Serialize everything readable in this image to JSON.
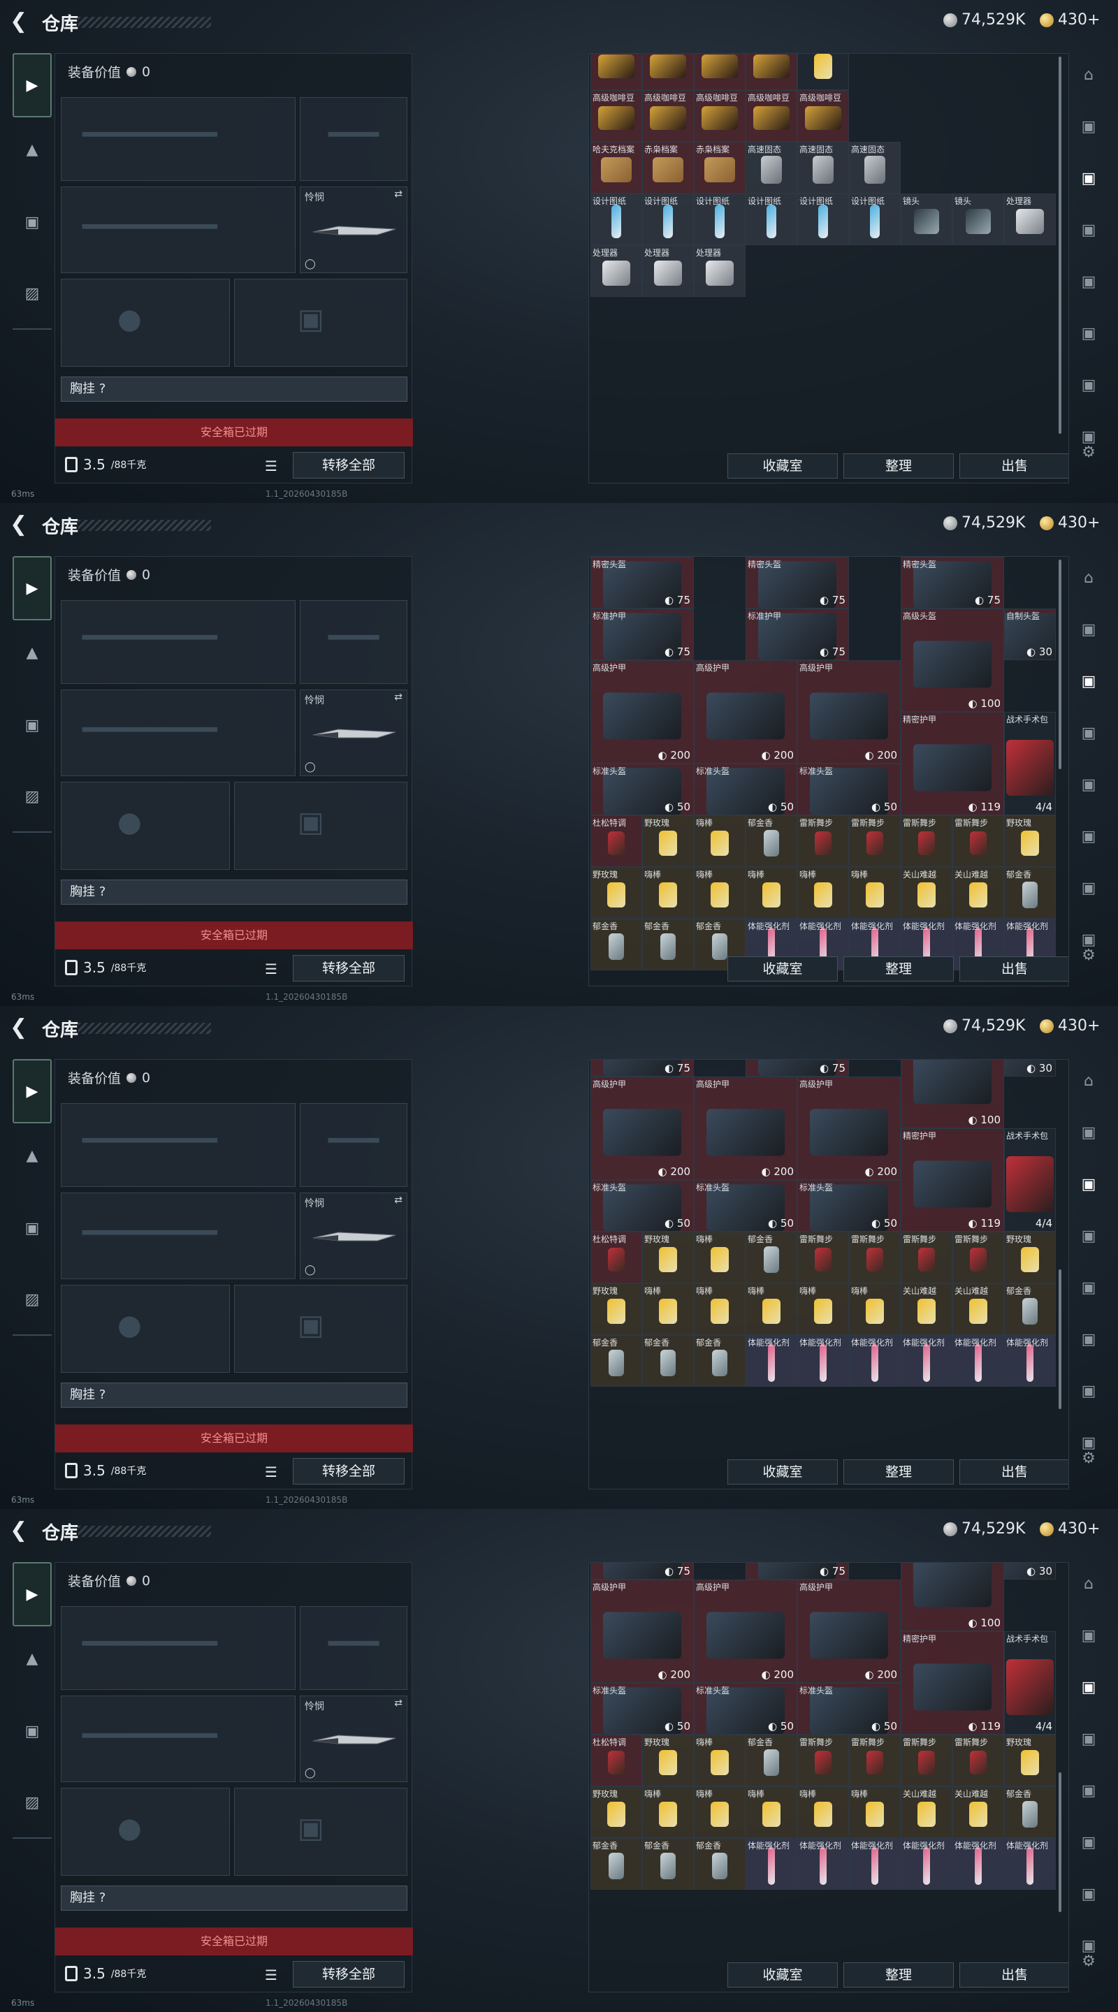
{
  "header": {
    "back_icon": "back-arrow-icon",
    "title": "仓库",
    "silver": "74,529K",
    "gold": "430+"
  },
  "left_nav": [
    "pistol-icon",
    "helmet-icon",
    "backpack-icon",
    "briefcase-icon"
  ],
  "equipment": {
    "value_label": "装备价值",
    "value": "0",
    "knife_label": "怜悯",
    "chest_label": "胸挂 ?",
    "safe_box": "安全箱已过期",
    "weight": "3.5",
    "weight_max": "/88千克",
    "transfer_all": "转移全部"
  },
  "buttons": {
    "collection": "收藏室",
    "sort": "整理",
    "sell": "出售"
  },
  "status": {
    "ping": "63ms",
    "build": "1.1_20260430185B"
  },
  "frames": [
    {
      "cells": [
        {
          "c": 0,
          "r": 0,
          "n": "高级咖啡豆"
        },
        {
          "c": 1,
          "r": 0,
          "n": "高级咖啡豆"
        },
        {
          "c": 2,
          "r": 0,
          "n": "高级咖啡豆"
        },
        {
          "c": 3,
          "r": 0,
          "n": "高级咖啡豆"
        },
        {
          "c": 4,
          "r": 0,
          "n": ""
        },
        {
          "c": 0,
          "r": 1,
          "n": "高级咖啡豆"
        },
        {
          "c": 1,
          "r": 1,
          "n": "高级咖啡豆"
        },
        {
          "c": 2,
          "r": 1,
          "n": "高级咖啡豆"
        },
        {
          "c": 3,
          "r": 1,
          "n": "高级咖啡豆"
        },
        {
          "c": 4,
          "r": 1,
          "n": "高级咖啡豆"
        },
        {
          "c": 0,
          "r": 2,
          "n": "哈夫克档案"
        },
        {
          "c": 1,
          "r": 2,
          "n": "赤枭档案"
        },
        {
          "c": 2,
          "r": 2,
          "n": "赤枭档案"
        },
        {
          "c": 3,
          "r": 2,
          "n": "高速固态"
        },
        {
          "c": 4,
          "r": 2,
          "n": "高速固态"
        },
        {
          "c": 5,
          "r": 2,
          "n": "高速固态"
        },
        {
          "c": 0,
          "r": 3,
          "n": "设计图纸"
        },
        {
          "c": 1,
          "r": 3,
          "n": "设计图纸"
        },
        {
          "c": 2,
          "r": 3,
          "n": "设计图纸"
        },
        {
          "c": 3,
          "r": 3,
          "n": "设计图纸"
        },
        {
          "c": 4,
          "r": 3,
          "n": "设计图纸"
        },
        {
          "c": 5,
          "r": 3,
          "n": "设计图纸"
        },
        {
          "c": 6,
          "r": 3,
          "n": "镜头"
        },
        {
          "c": 7,
          "r": 3,
          "n": "镜头"
        },
        {
          "c": 8,
          "r": 3,
          "n": "处理器"
        },
        {
          "c": 0,
          "r": 4,
          "n": "处理器"
        },
        {
          "c": 1,
          "r": 4,
          "n": "处理器"
        },
        {
          "c": 2,
          "r": 4,
          "n": "处理器"
        }
      ]
    },
    {
      "cells": [
        {
          "c": 0,
          "r": 0,
          "n": "精密头盔",
          "v": "75"
        },
        {
          "c": 3,
          "r": 0,
          "n": "精密头盔",
          "v": "75"
        },
        {
          "c": 6,
          "r": 0,
          "n": "精密头盔",
          "v": "75"
        },
        {
          "c": 0,
          "r": 1,
          "n": "标准护甲",
          "v": "75"
        },
        {
          "c": 3,
          "r": 1,
          "n": "标准护甲",
          "v": "75"
        },
        {
          "c": 6,
          "r": 1,
          "n": "高级头盔",
          "v": "100"
        },
        {
          "c": 8,
          "r": 1,
          "n": "自制头盔",
          "v": "30"
        },
        {
          "c": 0,
          "r": 2,
          "n": "高级护甲",
          "v": "200"
        },
        {
          "c": 2,
          "r": 2,
          "n": "高级护甲",
          "v": "200"
        },
        {
          "c": 4,
          "r": 2,
          "n": "高级护甲",
          "v": "200"
        },
        {
          "c": 6,
          "r": 3,
          "n": "精密护甲",
          "v": "119"
        },
        {
          "c": 8,
          "r": 3,
          "n": "战术手术包",
          "v": "4/4"
        },
        {
          "c": 0,
          "r": 4,
          "n": "标准头盔",
          "v": "50"
        },
        {
          "c": 2,
          "r": 4,
          "n": "标准头盔",
          "v": "50"
        },
        {
          "c": 4,
          "r": 4,
          "n": "标准头盔",
          "v": "50"
        },
        {
          "c": 0,
          "r": 5,
          "n": "杜松特调"
        },
        {
          "c": 1,
          "r": 5,
          "n": "野玫瑰"
        },
        {
          "c": 2,
          "r": 5,
          "n": "嗨棒"
        },
        {
          "c": 3,
          "r": 5,
          "n": "郁金香"
        },
        {
          "c": 4,
          "r": 5,
          "n": "雷斯舞步"
        },
        {
          "c": 5,
          "r": 5,
          "n": "雷斯舞步"
        },
        {
          "c": 6,
          "r": 5,
          "n": "雷斯舞步"
        },
        {
          "c": 7,
          "r": 5,
          "n": "雷斯舞步"
        },
        {
          "c": 8,
          "r": 5,
          "n": "野玫瑰"
        },
        {
          "c": 0,
          "r": 6,
          "n": "野玫瑰"
        },
        {
          "c": 1,
          "r": 6,
          "n": "嗨棒"
        },
        {
          "c": 2,
          "r": 6,
          "n": "嗨棒"
        },
        {
          "c": 3,
          "r": 6,
          "n": "嗨棒"
        },
        {
          "c": 4,
          "r": 6,
          "n": "嗨棒"
        },
        {
          "c": 5,
          "r": 6,
          "n": "嗨棒"
        },
        {
          "c": 6,
          "r": 6,
          "n": "关山难越"
        },
        {
          "c": 7,
          "r": 6,
          "n": "关山难越"
        },
        {
          "c": 8,
          "r": 6,
          "n": "郁金香"
        },
        {
          "c": 0,
          "r": 7,
          "n": "郁金香"
        },
        {
          "c": 1,
          "r": 7,
          "n": "郁金香"
        },
        {
          "c": 2,
          "r": 7,
          "n": "郁金香"
        },
        {
          "c": 3,
          "r": 7,
          "n": "体能强化剂"
        },
        {
          "c": 4,
          "r": 7,
          "n": "体能强化剂"
        },
        {
          "c": 5,
          "r": 7,
          "n": "体能强化剂"
        },
        {
          "c": 6,
          "r": 7,
          "n": "体能强化剂"
        },
        {
          "c": 7,
          "r": 7,
          "n": "体能强化剂"
        },
        {
          "c": 8,
          "r": 7,
          "n": "体能强化剂"
        }
      ]
    }
  ]
}
